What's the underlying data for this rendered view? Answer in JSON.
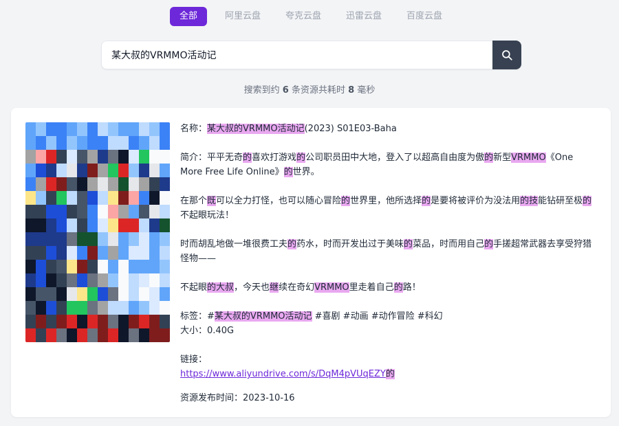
{
  "tabs": [
    {
      "label": "全部",
      "active": true
    },
    {
      "label": "阿里云盘",
      "active": false
    },
    {
      "label": "夸克云盘",
      "active": false
    },
    {
      "label": "迅雷云盘",
      "active": false
    },
    {
      "label": "百度云盘",
      "active": false
    }
  ],
  "search": {
    "value": "某大叔的VRMMO活动记",
    "button_icon": "search-icon"
  },
  "stats": {
    "prefix": "搜索到约",
    "count": "6",
    "middle": "条资源共耗时",
    "time": "8",
    "suffix": "毫秒"
  },
  "result": {
    "poster_image": "anime-poster",
    "name_label": "名称：",
    "name_highlight": "某大叔的VRMMO活动记",
    "name_rest": "(2023) S01E03-Baha",
    "intro_label": "简介：",
    "intro_parts": [
      {
        "t": "平平无奇",
        "h": false
      },
      {
        "t": "的",
        "h": true
      },
      {
        "t": "喜欢打游戏",
        "h": false
      },
      {
        "t": "的",
        "h": true
      },
      {
        "t": "公司职员田中大地，登入了以超高自由度为傲",
        "h": false
      },
      {
        "t": "的",
        "h": true
      },
      {
        "t": "新型",
        "h": false
      },
      {
        "t": "VRMMO",
        "h": true
      },
      {
        "t": "《One More Free Life Online》",
        "h": false
      },
      {
        "t": "的",
        "h": true
      },
      {
        "t": "世界。",
        "h": false
      }
    ],
    "para2_parts": [
      {
        "t": "在那个",
        "h": false
      },
      {
        "t": "既",
        "h": true
      },
      {
        "t": "可以全力打怪，也可以随心冒险",
        "h": false
      },
      {
        "t": "的",
        "h": true
      },
      {
        "t": "世界里，他所选择",
        "h": false
      },
      {
        "t": "的",
        "h": true
      },
      {
        "t": "是要将被评价为没法用",
        "h": false
      },
      {
        "t": "的技",
        "h": true
      },
      {
        "t": "能钻研至极",
        "h": false
      },
      {
        "t": "的",
        "h": true
      },
      {
        "t": "不起眼玩法！",
        "h": false
      }
    ],
    "para3_parts": [
      {
        "t": "时而胡乱地做一堆很费工夫",
        "h": false
      },
      {
        "t": "的",
        "h": true
      },
      {
        "t": "药水，时而开发出过于美味",
        "h": false
      },
      {
        "t": "的",
        "h": true
      },
      {
        "t": "菜品，时而用自己",
        "h": false
      },
      {
        "t": "的",
        "h": true
      },
      {
        "t": "手搓超常武器去享受狩猎怪物——",
        "h": false
      }
    ],
    "para4_parts": [
      {
        "t": "不起眼",
        "h": false
      },
      {
        "t": "的大叔",
        "h": true
      },
      {
        "t": "，今天也",
        "h": false
      },
      {
        "t": "继",
        "h": true
      },
      {
        "t": "续在奇幻",
        "h": false
      },
      {
        "t": "VRMMO",
        "h": true
      },
      {
        "t": "里走着自己",
        "h": false
      },
      {
        "t": "的",
        "h": true
      },
      {
        "t": "路！",
        "h": false
      }
    ],
    "tags_label": "标签：",
    "tags_parts": [
      {
        "t": "#",
        "h": false
      },
      {
        "t": "某大叔的VRMMO活动记",
        "h": true
      },
      {
        "t": " #喜剧 #动画 #动作冒险 #科幻",
        "h": false
      }
    ],
    "size_label": "大小：",
    "size_value": "0.40G",
    "link_label": "链接：",
    "link_url": "https://www.aliyundrive.com/s/DqM4pVUqEZY",
    "link_tail": "的",
    "date_label": "资源发布时间：",
    "date_value": "2023-10-16"
  },
  "colors": {
    "accent": "#6d28d9",
    "highlight": "#e9a8f0",
    "search_button": "#374151"
  }
}
